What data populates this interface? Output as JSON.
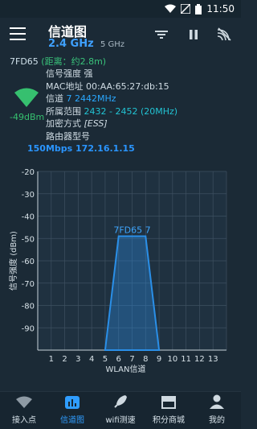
{
  "status": {
    "time": "11:50"
  },
  "header": {
    "title": "信道图",
    "band_active": "2.4 GHz",
    "band_other": "5 GHz"
  },
  "network": {
    "ssid": "7FD65",
    "distance": "(距离：约2.8m)",
    "signal_strength": "信号强度 强",
    "mac": "MAC地址 00:AA:65:27:db:15",
    "channel_label": "信道",
    "channel_value": "7 2442MHz",
    "range_label": "所属范围",
    "range_value": "2432 - 2452 (20MHz)",
    "encryption_label": "加密方式",
    "encryption_value": "[ESS]",
    "router_model": "路由器型号",
    "dbm": "-49dBm",
    "speed_ip": "150Mbps 172.16.1.15"
  },
  "chart_data": {
    "type": "area",
    "ylabel": "信号强度 (dBm)",
    "xlabel": "WLAN信道",
    "ylim": [
      -100,
      -20
    ],
    "yticks": [
      "-20",
      "-30",
      "-40",
      "-50",
      "-60",
      "-70",
      "-80",
      "-90"
    ],
    "xticks": [
      "1",
      "2",
      "3",
      "4",
      "5",
      "6",
      "7",
      "8",
      "9",
      "10",
      "11",
      "12",
      "13"
    ],
    "xlim": [
      0,
      14
    ],
    "grid": true,
    "series": [
      {
        "name": "7FD65 7",
        "channel": 7,
        "signal": -49,
        "x": [
          5,
          6,
          8,
          9
        ],
        "y": [
          -100,
          -49,
          -49,
          -100
        ]
      }
    ],
    "colors": {
      "series": "#2a8fe8",
      "fill": "rgba(42,143,232,0.35)"
    }
  },
  "nav": {
    "items": [
      "接入点",
      "信道图",
      "wifi测速",
      "积分商城",
      "我的"
    ],
    "active_index": 1
  },
  "colors": {
    "accent": "#2f9dff",
    "green": "#36c06f",
    "background": "#1b2a36"
  }
}
